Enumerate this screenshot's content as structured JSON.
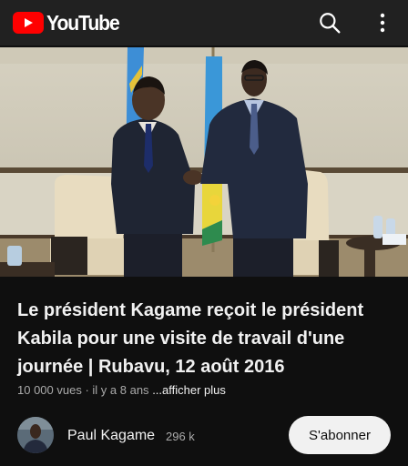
{
  "header": {
    "logo_text": "YouTube",
    "icons": {
      "search": "search-icon",
      "more": "more-vertical-icon"
    }
  },
  "video": {
    "title": "Le président Kagame reçoit le président Kabila pour une visite de travail d'une journée | Rubavu, 12 août 2016",
    "views": "10 000 vues",
    "separator": " · ",
    "age": "il y a 8 ans",
    "more_link": "...afficher plus"
  },
  "channel": {
    "name": "Paul Kagame",
    "subscribers": "296 k",
    "subscribe_label": "S'abonner"
  },
  "colors": {
    "background": "#0f0f0f",
    "header": "#212121",
    "brand_red": "#ff0000",
    "text_primary": "#f1f1f1",
    "text_secondary": "#aaaaaa"
  }
}
